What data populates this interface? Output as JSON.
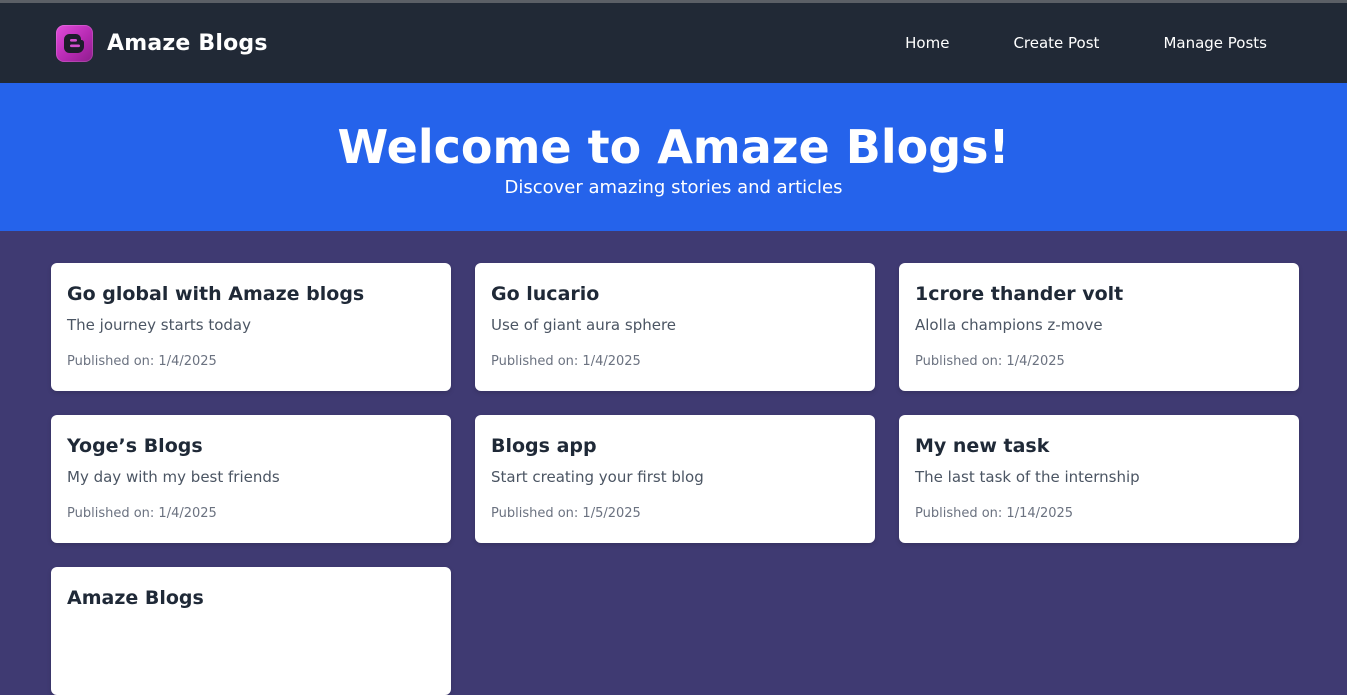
{
  "brand": {
    "name": "Amaze Blogs",
    "logo_icon": "blogger-icon"
  },
  "nav": [
    {
      "label": "Home"
    },
    {
      "label": "Create Post"
    },
    {
      "label": "Manage Posts"
    }
  ],
  "hero": {
    "title": "Welcome to Amaze Blogs!",
    "subtitle": "Discover amazing stories and articles"
  },
  "colors": {
    "navbar": "#212936",
    "hero": "#2563eb",
    "page_background": "#3f3a72",
    "logo": "#c43cc0"
  },
  "posts": [
    {
      "title": "Go global with Amaze blogs",
      "description": "The journey starts today",
      "published": "Published on: 1/4/2025"
    },
    {
      "title": "Go lucario",
      "description": "Use of giant aura sphere",
      "published": "Published on: 1/4/2025"
    },
    {
      "title": "1crore thander volt",
      "description": "Alolla champions z-move",
      "published": "Published on: 1/4/2025"
    },
    {
      "title": "Yoge’s Blogs",
      "description": "My day with my best friends",
      "published": "Published on: 1/4/2025"
    },
    {
      "title": "Blogs app",
      "description": "Start creating your first blog",
      "published": "Published on: 1/5/2025"
    },
    {
      "title": "My new task",
      "description": "The last task of the internship",
      "published": "Published on: 1/14/2025"
    },
    {
      "title": "Amaze Blogs",
      "description": "",
      "published": ""
    }
  ]
}
